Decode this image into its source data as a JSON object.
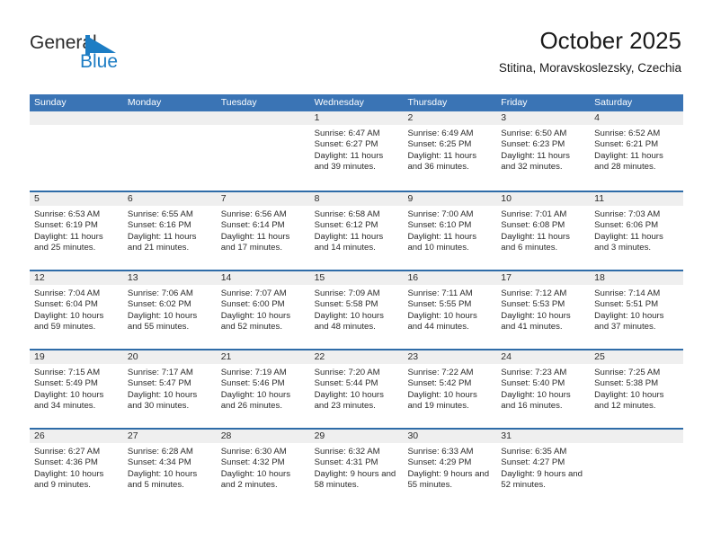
{
  "brand": {
    "name_part1": "General",
    "name_part2": "Blue",
    "triangle_color": "#1d7dc4"
  },
  "header": {
    "title": "October 2025",
    "subtitle": "Stitina, Moravskoslezsky, Czechia",
    "accent_color": "#3a74b5",
    "row_divider_color": "#2f6ca8",
    "date_strip_color": "#efefef"
  },
  "weekdays": [
    "Sunday",
    "Monday",
    "Tuesday",
    "Wednesday",
    "Thursday",
    "Friday",
    "Saturday"
  ],
  "weeks": [
    [
      {
        "day": "",
        "empty": true
      },
      {
        "day": "",
        "empty": true
      },
      {
        "day": "",
        "empty": true
      },
      {
        "day": "1",
        "sunrise": "Sunrise: 6:47 AM",
        "sunset": "Sunset: 6:27 PM",
        "daylight": "Daylight: 11 hours and 39 minutes."
      },
      {
        "day": "2",
        "sunrise": "Sunrise: 6:49 AM",
        "sunset": "Sunset: 6:25 PM",
        "daylight": "Daylight: 11 hours and 36 minutes."
      },
      {
        "day": "3",
        "sunrise": "Sunrise: 6:50 AM",
        "sunset": "Sunset: 6:23 PM",
        "daylight": "Daylight: 11 hours and 32 minutes."
      },
      {
        "day": "4",
        "sunrise": "Sunrise: 6:52 AM",
        "sunset": "Sunset: 6:21 PM",
        "daylight": "Daylight: 11 hours and 28 minutes."
      }
    ],
    [
      {
        "day": "5",
        "sunrise": "Sunrise: 6:53 AM",
        "sunset": "Sunset: 6:19 PM",
        "daylight": "Daylight: 11 hours and 25 minutes."
      },
      {
        "day": "6",
        "sunrise": "Sunrise: 6:55 AM",
        "sunset": "Sunset: 6:16 PM",
        "daylight": "Daylight: 11 hours and 21 minutes."
      },
      {
        "day": "7",
        "sunrise": "Sunrise: 6:56 AM",
        "sunset": "Sunset: 6:14 PM",
        "daylight": "Daylight: 11 hours and 17 minutes."
      },
      {
        "day": "8",
        "sunrise": "Sunrise: 6:58 AM",
        "sunset": "Sunset: 6:12 PM",
        "daylight": "Daylight: 11 hours and 14 minutes."
      },
      {
        "day": "9",
        "sunrise": "Sunrise: 7:00 AM",
        "sunset": "Sunset: 6:10 PM",
        "daylight": "Daylight: 11 hours and 10 minutes."
      },
      {
        "day": "10",
        "sunrise": "Sunrise: 7:01 AM",
        "sunset": "Sunset: 6:08 PM",
        "daylight": "Daylight: 11 hours and 6 minutes."
      },
      {
        "day": "11",
        "sunrise": "Sunrise: 7:03 AM",
        "sunset": "Sunset: 6:06 PM",
        "daylight": "Daylight: 11 hours and 3 minutes."
      }
    ],
    [
      {
        "day": "12",
        "sunrise": "Sunrise: 7:04 AM",
        "sunset": "Sunset: 6:04 PM",
        "daylight": "Daylight: 10 hours and 59 minutes."
      },
      {
        "day": "13",
        "sunrise": "Sunrise: 7:06 AM",
        "sunset": "Sunset: 6:02 PM",
        "daylight": "Daylight: 10 hours and 55 minutes."
      },
      {
        "day": "14",
        "sunrise": "Sunrise: 7:07 AM",
        "sunset": "Sunset: 6:00 PM",
        "daylight": "Daylight: 10 hours and 52 minutes."
      },
      {
        "day": "15",
        "sunrise": "Sunrise: 7:09 AM",
        "sunset": "Sunset: 5:58 PM",
        "daylight": "Daylight: 10 hours and 48 minutes."
      },
      {
        "day": "16",
        "sunrise": "Sunrise: 7:11 AM",
        "sunset": "Sunset: 5:55 PM",
        "daylight": "Daylight: 10 hours and 44 minutes."
      },
      {
        "day": "17",
        "sunrise": "Sunrise: 7:12 AM",
        "sunset": "Sunset: 5:53 PM",
        "daylight": "Daylight: 10 hours and 41 minutes."
      },
      {
        "day": "18",
        "sunrise": "Sunrise: 7:14 AM",
        "sunset": "Sunset: 5:51 PM",
        "daylight": "Daylight: 10 hours and 37 minutes."
      }
    ],
    [
      {
        "day": "19",
        "sunrise": "Sunrise: 7:15 AM",
        "sunset": "Sunset: 5:49 PM",
        "daylight": "Daylight: 10 hours and 34 minutes."
      },
      {
        "day": "20",
        "sunrise": "Sunrise: 7:17 AM",
        "sunset": "Sunset: 5:47 PM",
        "daylight": "Daylight: 10 hours and 30 minutes."
      },
      {
        "day": "21",
        "sunrise": "Sunrise: 7:19 AM",
        "sunset": "Sunset: 5:46 PM",
        "daylight": "Daylight: 10 hours and 26 minutes."
      },
      {
        "day": "22",
        "sunrise": "Sunrise: 7:20 AM",
        "sunset": "Sunset: 5:44 PM",
        "daylight": "Daylight: 10 hours and 23 minutes."
      },
      {
        "day": "23",
        "sunrise": "Sunrise: 7:22 AM",
        "sunset": "Sunset: 5:42 PM",
        "daylight": "Daylight: 10 hours and 19 minutes."
      },
      {
        "day": "24",
        "sunrise": "Sunrise: 7:23 AM",
        "sunset": "Sunset: 5:40 PM",
        "daylight": "Daylight: 10 hours and 16 minutes."
      },
      {
        "day": "25",
        "sunrise": "Sunrise: 7:25 AM",
        "sunset": "Sunset: 5:38 PM",
        "daylight": "Daylight: 10 hours and 12 minutes."
      }
    ],
    [
      {
        "day": "26",
        "sunrise": "Sunrise: 6:27 AM",
        "sunset": "Sunset: 4:36 PM",
        "daylight": "Daylight: 10 hours and 9 minutes."
      },
      {
        "day": "27",
        "sunrise": "Sunrise: 6:28 AM",
        "sunset": "Sunset: 4:34 PM",
        "daylight": "Daylight: 10 hours and 5 minutes."
      },
      {
        "day": "28",
        "sunrise": "Sunrise: 6:30 AM",
        "sunset": "Sunset: 4:32 PM",
        "daylight": "Daylight: 10 hours and 2 minutes."
      },
      {
        "day": "29",
        "sunrise": "Sunrise: 6:32 AM",
        "sunset": "Sunset: 4:31 PM",
        "daylight": "Daylight: 9 hours and 58 minutes."
      },
      {
        "day": "30",
        "sunrise": "Sunrise: 6:33 AM",
        "sunset": "Sunset: 4:29 PM",
        "daylight": "Daylight: 9 hours and 55 minutes."
      },
      {
        "day": "31",
        "sunrise": "Sunrise: 6:35 AM",
        "sunset": "Sunset: 4:27 PM",
        "daylight": "Daylight: 9 hours and 52 minutes."
      },
      {
        "day": "",
        "empty": true
      }
    ]
  ]
}
